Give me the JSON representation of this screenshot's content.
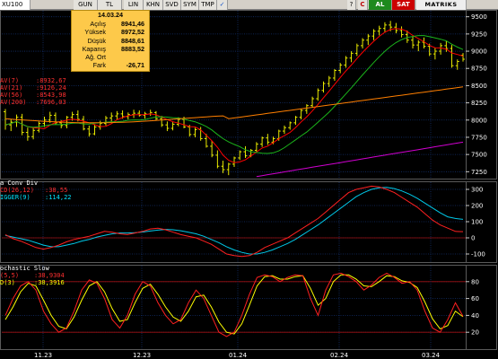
{
  "toolbar": {
    "symbol": "XU100",
    "periods": [
      "GUN",
      "TL",
      "LIN",
      "KHN",
      "SVD",
      "SYM",
      "TMP"
    ],
    "extra": [
      "?",
      "C",
      "AL",
      "SAT",
      "MATRIKS"
    ]
  },
  "info_popup": {
    "date": "14.03.24",
    "rows": [
      {
        "label": "Açılış",
        "value": "8941,46"
      },
      {
        "label": "Yüksek",
        "value": "8972,52"
      },
      {
        "label": "Düşük",
        "value": "8848,61"
      },
      {
        "label": "Kapanış",
        "value": "8883,52"
      },
      {
        "label": "Ağ. Ort",
        "value": ""
      },
      {
        "label": "Fark",
        "value": "-26,71"
      }
    ]
  },
  "panels": {
    "price": {
      "legend": [
        {
          "label": "AV(7)",
          "value": ":8932,67",
          "color": "#ff3030"
        },
        {
          "label": "AV(21)",
          "value": ":9126,24",
          "color": "#ff3030"
        },
        {
          "label": "AV(56)",
          "value": ":8543,98",
          "color": "#ff3030"
        },
        {
          "label": "AV(200)",
          "value": ":7696,03",
          "color": "#ff3030"
        }
      ],
      "y_ticks": [
        "9500",
        "9250",
        "9000",
        "8750",
        "8500",
        "8250",
        "8000",
        "7750",
        "7500",
        "7250"
      ]
    },
    "macd": {
      "title": "a Conv Div",
      "legend": [
        {
          "label": "CD(26,12)",
          "value": ":38,55",
          "color": "#ff3030"
        },
        {
          "label": "IGGER(9)",
          "value": ":114,22",
          "color": "#00e5ff"
        }
      ],
      "y_ticks": [
        "300",
        "200",
        "100",
        "0",
        "-100"
      ]
    },
    "stoch": {
      "title": "ochastic Slow",
      "legend": [
        {
          "label": "(5,5)",
          "value": ":38,9304",
          "color": "#ff3030"
        },
        {
          "label": "D(3)",
          "value": ":38,3916",
          "color": "#ffff00"
        }
      ],
      "y_ticks": [
        "80",
        "60",
        "40",
        "20"
      ]
    }
  },
  "x_ticks": [
    "11.23",
    "12.23",
    "01.24",
    "02.24",
    "03.24"
  ],
  "colors": {
    "background": "#000000",
    "grid": "#13306e",
    "candle": "#ffff00",
    "ma_red": "#ff0000",
    "ma_green": "#1bb41b",
    "ma_orange": "#ff7f00",
    "ma_magenta": "#d000d0",
    "macd": "#ff2020",
    "trigger": "#00c8e8",
    "stoch_k": "#ff2020",
    "stoch_d": "#ffff00"
  },
  "chart_data": [
    {
      "type": "candlestick",
      "title": "XU100",
      "ylim": [
        7150,
        9600
      ],
      "ohlc": [
        [
          8120,
          8160,
          7860,
          7930
        ],
        [
          7930,
          8010,
          7840,
          7970
        ],
        [
          7970,
          8080,
          7900,
          8040
        ],
        [
          8040,
          8090,
          7780,
          7820
        ],
        [
          7820,
          7890,
          7700,
          7760
        ],
        [
          7760,
          7900,
          7720,
          7850
        ],
        [
          7850,
          7980,
          7820,
          7950
        ],
        [
          7950,
          8050,
          7900,
          8000
        ],
        [
          8000,
          8120,
          7960,
          8070
        ],
        [
          8070,
          8110,
          7930,
          7960
        ],
        [
          7960,
          8000,
          7880,
          7920
        ],
        [
          7920,
          8060,
          7880,
          8040
        ],
        [
          8040,
          8120,
          7990,
          8080
        ],
        [
          8080,
          8140,
          7980,
          8010
        ],
        [
          8010,
          8060,
          7850,
          7870
        ],
        [
          7870,
          7920,
          7760,
          7800
        ],
        [
          7800,
          7940,
          7780,
          7900
        ],
        [
          7900,
          7990,
          7860,
          7950
        ],
        [
          7950,
          8060,
          7920,
          8030
        ],
        [
          8030,
          8110,
          7980,
          8060
        ],
        [
          8060,
          8130,
          8000,
          8090
        ],
        [
          8090,
          8140,
          8020,
          8050
        ],
        [
          8050,
          8110,
          8010,
          8080
        ],
        [
          8080,
          8150,
          8030,
          8100
        ],
        [
          8100,
          8140,
          8050,
          8070
        ],
        [
          8070,
          8120,
          8020,
          8090
        ],
        [
          8090,
          8150,
          8060,
          8110
        ],
        [
          8110,
          8130,
          8000,
          8020
        ],
        [
          8020,
          8060,
          7900,
          7930
        ],
        [
          7930,
          7980,
          7840,
          7880
        ],
        [
          7880,
          7970,
          7850,
          7940
        ],
        [
          7940,
          8040,
          7910,
          8010
        ],
        [
          8010,
          8050,
          7880,
          7900
        ],
        [
          7900,
          7930,
          7760,
          7790
        ],
        [
          7790,
          7890,
          7750,
          7860
        ],
        [
          7860,
          7900,
          7700,
          7730
        ],
        [
          7730,
          7800,
          7600,
          7620
        ],
        [
          7620,
          7700,
          7460,
          7490
        ],
        [
          7490,
          7560,
          7300,
          7330
        ],
        [
          7330,
          7410,
          7230,
          7280
        ],
        [
          7280,
          7380,
          7200,
          7360
        ],
        [
          7360,
          7470,
          7320,
          7450
        ],
        [
          7450,
          7560,
          7420,
          7540
        ],
        [
          7540,
          7620,
          7450,
          7480
        ],
        [
          7480,
          7580,
          7460,
          7560
        ],
        [
          7560,
          7680,
          7520,
          7650
        ],
        [
          7650,
          7760,
          7610,
          7740
        ],
        [
          7740,
          7800,
          7640,
          7680
        ],
        [
          7680,
          7760,
          7650,
          7730
        ],
        [
          7730,
          7860,
          7700,
          7840
        ],
        [
          7840,
          7920,
          7800,
          7890
        ],
        [
          7890,
          7980,
          7860,
          7960
        ],
        [
          7960,
          8060,
          7930,
          8040
        ],
        [
          8040,
          8160,
          8010,
          8140
        ],
        [
          8140,
          8230,
          8090,
          8210
        ],
        [
          8210,
          8340,
          8180,
          8310
        ],
        [
          8310,
          8460,
          8280,
          8430
        ],
        [
          8430,
          8560,
          8400,
          8530
        ],
        [
          8530,
          8640,
          8480,
          8610
        ],
        [
          8610,
          8740,
          8570,
          8720
        ],
        [
          8720,
          8830,
          8680,
          8800
        ],
        [
          8800,
          8930,
          8760,
          8900
        ],
        [
          8900,
          9000,
          8840,
          8970
        ],
        [
          8970,
          9110,
          8930,
          9080
        ],
        [
          9080,
          9190,
          9040,
          9160
        ],
        [
          9160,
          9250,
          9090,
          9220
        ],
        [
          9220,
          9320,
          9160,
          9290
        ],
        [
          9290,
          9370,
          9230,
          9330
        ],
        [
          9330,
          9420,
          9270,
          9380
        ],
        [
          9380,
          9440,
          9290,
          9350
        ],
        [
          9350,
          9410,
          9260,
          9300
        ],
        [
          9300,
          9360,
          9200,
          9240
        ],
        [
          9240,
          9300,
          9120,
          9160
        ],
        [
          9160,
          9220,
          9040,
          9090
        ],
        [
          9090,
          9160,
          9000,
          9130
        ],
        [
          9130,
          9200,
          9040,
          9070
        ],
        [
          9070,
          9110,
          8930,
          8960
        ],
        [
          8960,
          9050,
          8880,
          9000
        ],
        [
          9000,
          9120,
          8950,
          9080
        ],
        [
          9080,
          9150,
          8990,
          9040
        ],
        [
          9040,
          9090,
          8760,
          8790
        ],
        [
          8790,
          8880,
          8730,
          8850
        ],
        [
          8941.46,
          8972.52,
          8848.61,
          8883.52
        ]
      ],
      "moving_averages": [
        {
          "name": "AV(7)",
          "last": 8932.67
        },
        {
          "name": "AV(21)",
          "last": 9126.24
        },
        {
          "name": "AV(56)",
          "last": 8543.98
        },
        {
          "name": "AV(200)",
          "last": 7696.03
        }
      ]
    },
    {
      "type": "line",
      "title": "a Conv Div",
      "ylim": [
        -150,
        350
      ],
      "series": [
        {
          "name": "CD(26,12)",
          "values": [
            20,
            -5,
            -20,
            -40,
            -60,
            -70,
            -60,
            -45,
            -25,
            -10,
            0,
            10,
            25,
            40,
            35,
            25,
            20,
            30,
            40,
            55,
            60,
            50,
            35,
            20,
            10,
            0,
            -20,
            -40,
            -70,
            -100,
            -110,
            -115,
            -110,
            -90,
            -60,
            -40,
            -20,
            0,
            30,
            60,
            90,
            120,
            160,
            200,
            240,
            280,
            300,
            310,
            320,
            315,
            300,
            280,
            250,
            220,
            190,
            150,
            110,
            80,
            60,
            40,
            38.55
          ]
        },
        {
          "name": "IGGER(9)",
          "values": [
            15,
            5,
            -5,
            -15,
            -30,
            -45,
            -55,
            -55,
            -45,
            -35,
            -20,
            -10,
            5,
            15,
            25,
            30,
            30,
            32,
            36,
            42,
            48,
            52,
            50,
            44,
            35,
            25,
            10,
            -10,
            -30,
            -55,
            -75,
            -90,
            -100,
            -100,
            -90,
            -75,
            -55,
            -35,
            -10,
            20,
            50,
            80,
            115,
            150,
            185,
            220,
            255,
            280,
            300,
            310,
            312,
            305,
            290,
            270,
            245,
            215,
            185,
            155,
            130,
            120,
            114.22
          ]
        }
      ]
    },
    {
      "type": "line",
      "title": "ochastic Slow",
      "ylim": [
        0,
        100
      ],
      "series": [
        {
          "name": "(5,5)",
          "values": [
            40,
            60,
            75,
            80,
            70,
            45,
            30,
            20,
            25,
            45,
            70,
            82,
            78,
            60,
            35,
            25,
            40,
            65,
            80,
            75,
            55,
            40,
            30,
            35,
            55,
            70,
            60,
            40,
            20,
            15,
            20,
            40,
            65,
            85,
            88,
            86,
            80,
            85,
            88,
            87,
            60,
            40,
            70,
            88,
            90,
            86,
            80,
            70,
            76,
            85,
            90,
            85,
            78,
            80,
            70,
            45,
            25,
            20,
            35,
            55,
            38.93
          ]
        },
        {
          "name": "D(3)",
          "values": [
            35,
            50,
            68,
            78,
            75,
            58,
            40,
            27,
            24,
            38,
            58,
            75,
            80,
            68,
            48,
            33,
            35,
            55,
            72,
            77,
            65,
            50,
            38,
            33,
            45,
            62,
            64,
            50,
            32,
            20,
            18,
            30,
            52,
            75,
            86,
            87,
            83,
            83,
            86,
            87,
            72,
            52,
            60,
            80,
            88,
            88,
            83,
            75,
            74,
            80,
            87,
            86,
            81,
            79,
            73,
            56,
            36,
            24,
            28,
            45,
            38.39
          ]
        }
      ]
    }
  ]
}
